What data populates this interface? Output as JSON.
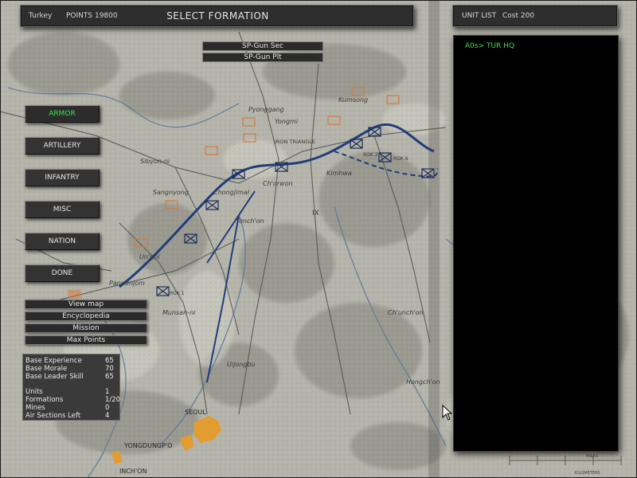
{
  "header": {
    "country": "Turkey",
    "points": "POINTS 19800",
    "title": "SELECT FORMATION"
  },
  "unit_panel": {
    "label": "UNIT LIST",
    "cost": "Cost 200",
    "items": [
      "A0s> TUR HQ"
    ]
  },
  "formations": [
    "SP-Gun Sec",
    "SP-Gun Plt"
  ],
  "categories": [
    {
      "label": "ARMOR",
      "active": true
    },
    {
      "label": "ARTILLERY"
    },
    {
      "label": "INFANTRY"
    },
    {
      "label": "MISC"
    },
    {
      "label": "NATION"
    },
    {
      "label": "DONE"
    }
  ],
  "actions": [
    "View map",
    "Encyclopedia",
    "Mission",
    "Max Points"
  ],
  "stats": {
    "base_experience": {
      "label": "Base Experience",
      "value": "65"
    },
    "base_morale": {
      "label": "Base Morale",
      "value": "70"
    },
    "base_leader_skill": {
      "label": "Base Leader Skill",
      "value": "65"
    },
    "units": {
      "label": "Units",
      "value": "1"
    },
    "formations": {
      "label": "Formations",
      "value": "1/20"
    },
    "mines": {
      "label": "Mines",
      "value": "0"
    },
    "air_sections_left": {
      "label": "Air Sections Left",
      "value": "4"
    }
  },
  "map": {
    "places": [
      "Pyonggang",
      "Kumsong",
      "Yongmi",
      "IRON TRIANGLE",
      "Sibyon-ni",
      "Sangnyong",
      "Chongjimal",
      "Ch'orwon",
      "Kimhwa",
      "Yonch'on",
      "Un'gol",
      "Pannunjom",
      "Munsan-ni",
      "Uijongbu",
      "SEOUL",
      "YONGDUNGP'O",
      "INCH'ON",
      "Ch'unch'on",
      "Hongch'on",
      "ROK 2",
      "ROK 6",
      "ROK 1",
      "IX",
      "MILES",
      "KILOMETERS"
    ],
    "colors": {
      "land": "#b9b8ae",
      "terrain": "#8f9088",
      "roads": "#5b5f60",
      "rivers": "#5b7a9c",
      "front_line": "#1f3e7a",
      "units": "#d77a3c",
      "urban": "#e39c2f"
    }
  }
}
